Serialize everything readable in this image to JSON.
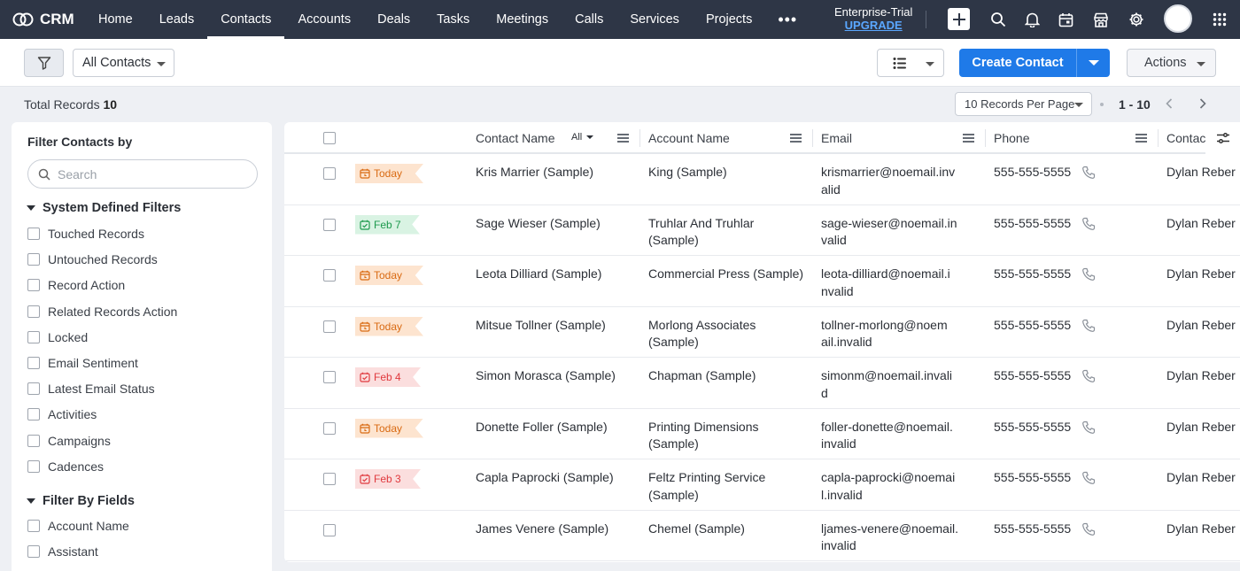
{
  "app": {
    "name": "CRM"
  },
  "nav": {
    "items": [
      {
        "label": "Home",
        "active": false
      },
      {
        "label": "Leads",
        "active": false
      },
      {
        "label": "Contacts",
        "active": true
      },
      {
        "label": "Accounts",
        "active": false
      },
      {
        "label": "Deals",
        "active": false
      },
      {
        "label": "Tasks",
        "active": false
      },
      {
        "label": "Meetings",
        "active": false
      },
      {
        "label": "Calls",
        "active": false
      },
      {
        "label": "Services",
        "active": false
      },
      {
        "label": "Projects",
        "active": false
      }
    ],
    "more": "•••",
    "trial_label": "Enterprise-Trial",
    "upgrade_label": "UPGRADE"
  },
  "toolbar": {
    "view_name": "All Contacts",
    "create_label": "Create Contact",
    "actions_label": "Actions"
  },
  "records": {
    "total_label": "Total Records",
    "total": "10",
    "per_page": "10 Records Per Page",
    "range": "1 - 10"
  },
  "filters": {
    "title": "Filter Contacts by",
    "search_placeholder": "Search",
    "system_title": "System Defined Filters",
    "system_items": [
      "Touched Records",
      "Untouched Records",
      "Record Action",
      "Related Records Action",
      "Locked",
      "Email Sentiment",
      "Latest Email Status",
      "Activities",
      "Campaigns",
      "Cadences"
    ],
    "fields_title": "Filter By Fields",
    "field_items": [
      "Account Name",
      "Assistant"
    ]
  },
  "table": {
    "columns": {
      "contact_name": "Contact Name",
      "all_label": "All",
      "account_name": "Account Name",
      "email": "Email",
      "phone": "Phone",
      "contact_owner": "Contac"
    },
    "rows": [
      {
        "tag": "Today",
        "tag_type": "today",
        "name": "Kris Marrier (Sample)",
        "account": [
          "King (Sample)"
        ],
        "email": [
          "krismarrier@noemail.inv",
          "alid"
        ],
        "phone": "555-555-5555",
        "owner": "Dylan Reber"
      },
      {
        "tag": "Feb 7",
        "tag_type": "green",
        "name": "Sage Wieser (Sample)",
        "account": [
          "Truhlar And Truhlar",
          "(Sample)"
        ],
        "email": [
          "sage-wieser@noemail.in",
          "valid"
        ],
        "phone": "555-555-5555",
        "owner": "Dylan Reber"
      },
      {
        "tag": "Today",
        "tag_type": "today",
        "name": "Leota Dilliard (Sample)",
        "account": [
          "Commercial Press (Sample)"
        ],
        "email": [
          "leota-dilliard@noemail.i",
          "nvalid"
        ],
        "phone": "555-555-5555",
        "owner": "Dylan Reber"
      },
      {
        "tag": "Today",
        "tag_type": "today",
        "name": "Mitsue Tollner (Sample)",
        "account": [
          "Morlong Associates",
          "(Sample)"
        ],
        "email": [
          "tollner-morlong@noem",
          "ail.invalid"
        ],
        "phone": "555-555-5555",
        "owner": "Dylan Reber"
      },
      {
        "tag": "Feb 4",
        "tag_type": "red",
        "name": "Simon Morasca (Sample)",
        "account": [
          "Chapman (Sample)"
        ],
        "email": [
          "simonm@noemail.invali",
          "d"
        ],
        "phone": "555-555-5555",
        "owner": "Dylan Reber"
      },
      {
        "tag": "Today",
        "tag_type": "today",
        "name": "Donette Foller (Sample)",
        "account": [
          "Printing Dimensions",
          "(Sample)"
        ],
        "email": [
          "foller-donette@noemail.",
          "invalid"
        ],
        "phone": "555-555-5555",
        "owner": "Dylan Reber"
      },
      {
        "tag": "Feb 3",
        "tag_type": "red",
        "name": "Capla Paprocki (Sample)",
        "account": [
          "Feltz Printing Service",
          "(Sample)"
        ],
        "email": [
          "capla-paprocki@noemai",
          "l.invalid"
        ],
        "phone": "555-555-5555",
        "owner": "Dylan Reber"
      },
      {
        "tag": "",
        "tag_type": "none",
        "name": "James Venere (Sample)",
        "account": [
          "Chemel (Sample)"
        ],
        "email": [
          "ljames-venere@noemail.",
          "invalid"
        ],
        "phone": "555-555-5555",
        "owner": "Dylan Reber"
      }
    ]
  },
  "colors": {
    "nav_bg": "#2e3646",
    "primary": "#1f7ae8",
    "upgrade": "#5aa7ff",
    "tag_today": "#d96a12",
    "tag_green": "#1d9a4d",
    "tag_red": "#e0393e"
  },
  "icons": [
    "crm-logo-icon",
    "plus-icon",
    "search-icon",
    "bell-icon",
    "calendar-icon",
    "marketplace-icon",
    "gear-icon",
    "apps-grid-icon",
    "filter-funnel-icon",
    "list-view-icon",
    "phone-icon",
    "column-settings-icon"
  ]
}
